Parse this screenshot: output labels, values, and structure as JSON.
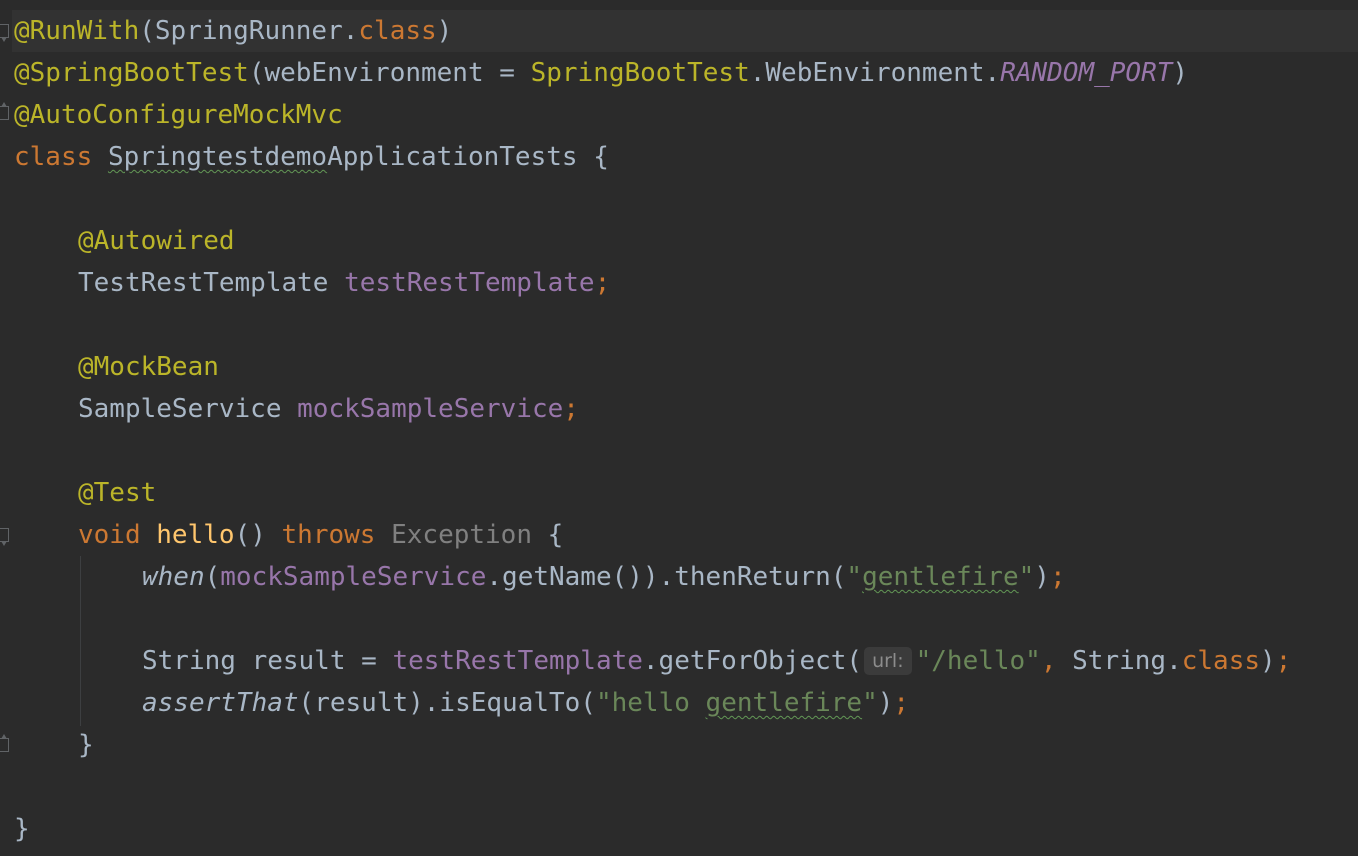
{
  "editor": {
    "file_language": "java",
    "colors": {
      "background": "#2b2b2b",
      "annotation": "#bbb529",
      "keyword": "#cc7832",
      "field": "#9876aa",
      "method_declaration": "#ffc66d",
      "string": "#6a8759",
      "default_text": "#a9b7c6",
      "unused": "#808080"
    },
    "lines": {
      "l1": {
        "ann": "@RunWith",
        "p1": "(SpringRunner.",
        "kw": "class",
        "p2": ")"
      },
      "l2": {
        "ann": "@SpringBootTest",
        "p1": "(webEnvironment = ",
        "ann2": "SpringBootTest",
        "p2": ".WebEnvironment.",
        "field": "RANDOM_PORT",
        "p3": ")"
      },
      "l3": {
        "ann": "@AutoConfigureMockMvc"
      },
      "l4": {
        "kw": "class",
        "sp": " ",
        "name_typo": "Springtestdemo",
        "name_rest": "ApplicationTests",
        "p1": " {"
      },
      "l6": {
        "ann": "@Autowired"
      },
      "l7": {
        "type": "TestRestTemplate ",
        "field": "testRestTemplate",
        "semi": ";"
      },
      "l9": {
        "ann": "@MockBean"
      },
      "l10": {
        "type": "SampleService ",
        "field": "mockSampleService",
        "semi": ";"
      },
      "l12": {
        "ann": "@Test"
      },
      "l13": {
        "kw1": "void",
        "sp1": " ",
        "method": "hello",
        "p1": "() ",
        "kw2": "throws",
        "sp2": " ",
        "exc": "Exception",
        "p2": " {"
      },
      "l14": {
        "call": "when",
        "p1": "(",
        "field": "mockSampleService",
        "p2": ".getName()).thenReturn(",
        "q1": "\"",
        "str_typo": "gentlefire",
        "q2": "\"",
        "p3": ")",
        "semi": ";"
      },
      "l16": {
        "p1": "String result = ",
        "field": "testRestTemplate",
        "p2": ".getForObject(",
        "hint": "url:",
        "str": "\"/hello\"",
        "comma": ",",
        "p3": " String.",
        "kw": "class",
        "p4": ")",
        "semi": ";"
      },
      "l17": {
        "call": "assertThat",
        "p1": "(result).isEqualTo(",
        "str1": "\"hello ",
        "str_typo": "gentlefire",
        "str2": "\"",
        "p2": ")",
        "semi": ";"
      },
      "l18": {
        "brace": "}"
      },
      "l20": {
        "brace": "}"
      }
    }
  }
}
